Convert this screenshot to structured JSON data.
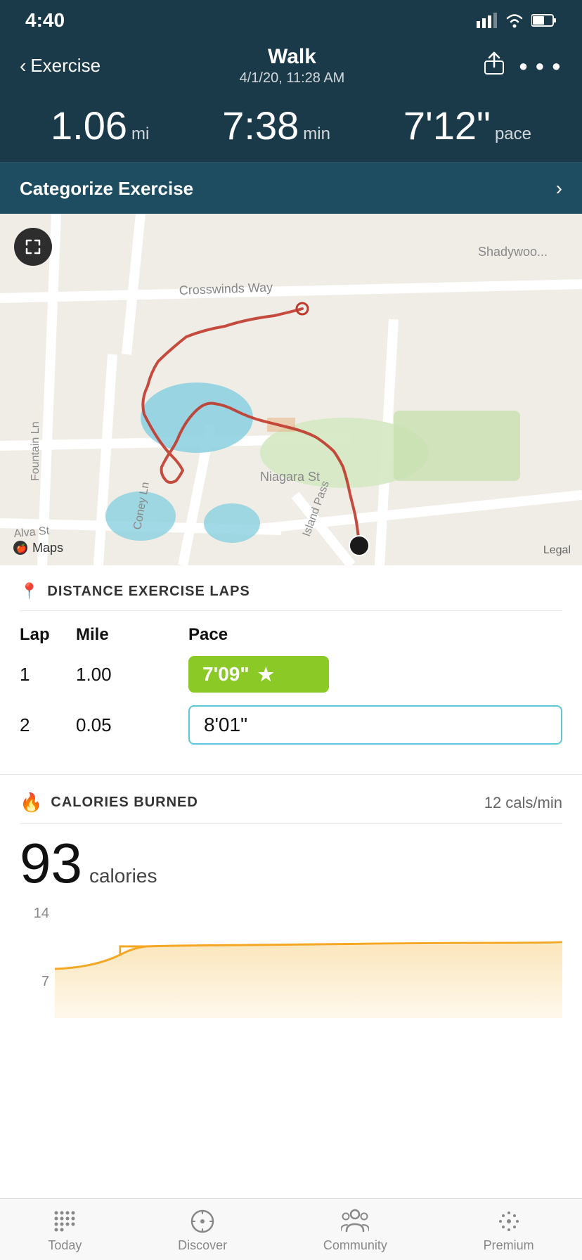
{
  "statusBar": {
    "time": "4:40",
    "signal": "▋▋▋",
    "wifi": "wifi",
    "battery": "battery"
  },
  "header": {
    "backLabel": "Exercise",
    "title": "Walk",
    "subtitle": "4/1/20, 11:28 AM"
  },
  "stats": {
    "distance": {
      "value": "1.06",
      "unit": "mi"
    },
    "duration": {
      "value": "7:38",
      "unit": "min"
    },
    "pace": {
      "value": "7'12\"",
      "unit": "pace"
    }
  },
  "categorize": {
    "label": "Categorize Exercise",
    "chevron": "›"
  },
  "map": {
    "legal": "Legal",
    "logo": "Maps"
  },
  "lapsSection": {
    "title": "DISTANCE EXERCISE LAPS",
    "headers": {
      "lap": "Lap",
      "mile": "Mile",
      "pace": "Pace"
    },
    "rows": [
      {
        "lap": "1",
        "mile": "1.00",
        "pace": "7'09\"",
        "best": true
      },
      {
        "lap": "2",
        "mile": "0.05",
        "pace": "8'01\"",
        "best": false
      }
    ]
  },
  "caloriesSection": {
    "title": "CALORIES BURNED",
    "rate": "12 cals/min",
    "calories": "93",
    "caloriesUnit": "calories",
    "chartLabels": [
      "14",
      "7"
    ]
  },
  "bottomNav": {
    "items": [
      {
        "label": "Today",
        "active": false
      },
      {
        "label": "Discover",
        "active": false
      },
      {
        "label": "Community",
        "active": false
      },
      {
        "label": "Premium",
        "active": false
      }
    ]
  }
}
